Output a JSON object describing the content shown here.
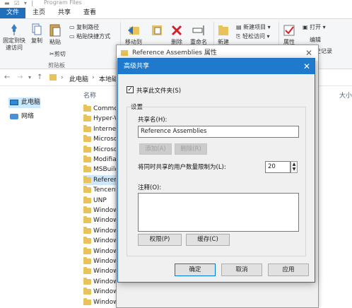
{
  "explorer": {
    "title": "Program Files",
    "tabs": [
      "文件",
      "主页",
      "共享",
      "查看"
    ],
    "ribbon": {
      "pin": "固定到快\n速访问",
      "copy": "复制",
      "paste": "粘贴",
      "copy_path": "复制路径",
      "paste_shortcut": "粘贴快捷方式",
      "cut": "剪切",
      "clipboard_group": "剪贴板",
      "move_to": "移动到",
      "delete": "删除",
      "rename": "重命名",
      "new_folder": "新建",
      "new_item": "新建项目",
      "easy_access": "轻松访问",
      "properties": "属性",
      "open": "打开",
      "edit": "编辑",
      "history": "历史记录"
    },
    "address": {
      "path_this_pc": "此电脑",
      "path_local": "本地磁"
    },
    "nav": [
      "此电脑",
      "网络"
    ],
    "list": {
      "column_name": "名称",
      "column_size": "大小",
      "rows": [
        "Common",
        "Hyper-V",
        "Internet",
        "Microso",
        "Microso",
        "Modifia",
        "MSBuild",
        "Referen",
        "Tencent",
        "UNP",
        "Window",
        "Window",
        "Window",
        "Window",
        "Window",
        "Window",
        "Window",
        "Window",
        "Window",
        "Window"
      ]
    }
  },
  "properties_window": {
    "title": "Reference Assemblies 属性"
  },
  "dialog": {
    "title": "高级共享",
    "share_checkbox_label": "共享此文件夹(S)",
    "share_checked": true,
    "settings_label": "设置",
    "share_name_label": "共享名(H):",
    "share_name_value": "Reference Assemblies",
    "add_button": "添加(A)",
    "remove_button": "删除(R)",
    "limit_label": "将同时共享的用户数量限制为(L):",
    "limit_value": "20",
    "comment_label": "注释(O):",
    "comment_value": "",
    "permissions_button": "权限(P)",
    "caching_button": "缓存(C)",
    "ok_button": "确定",
    "cancel_button": "取消",
    "apply_button": "应用"
  }
}
